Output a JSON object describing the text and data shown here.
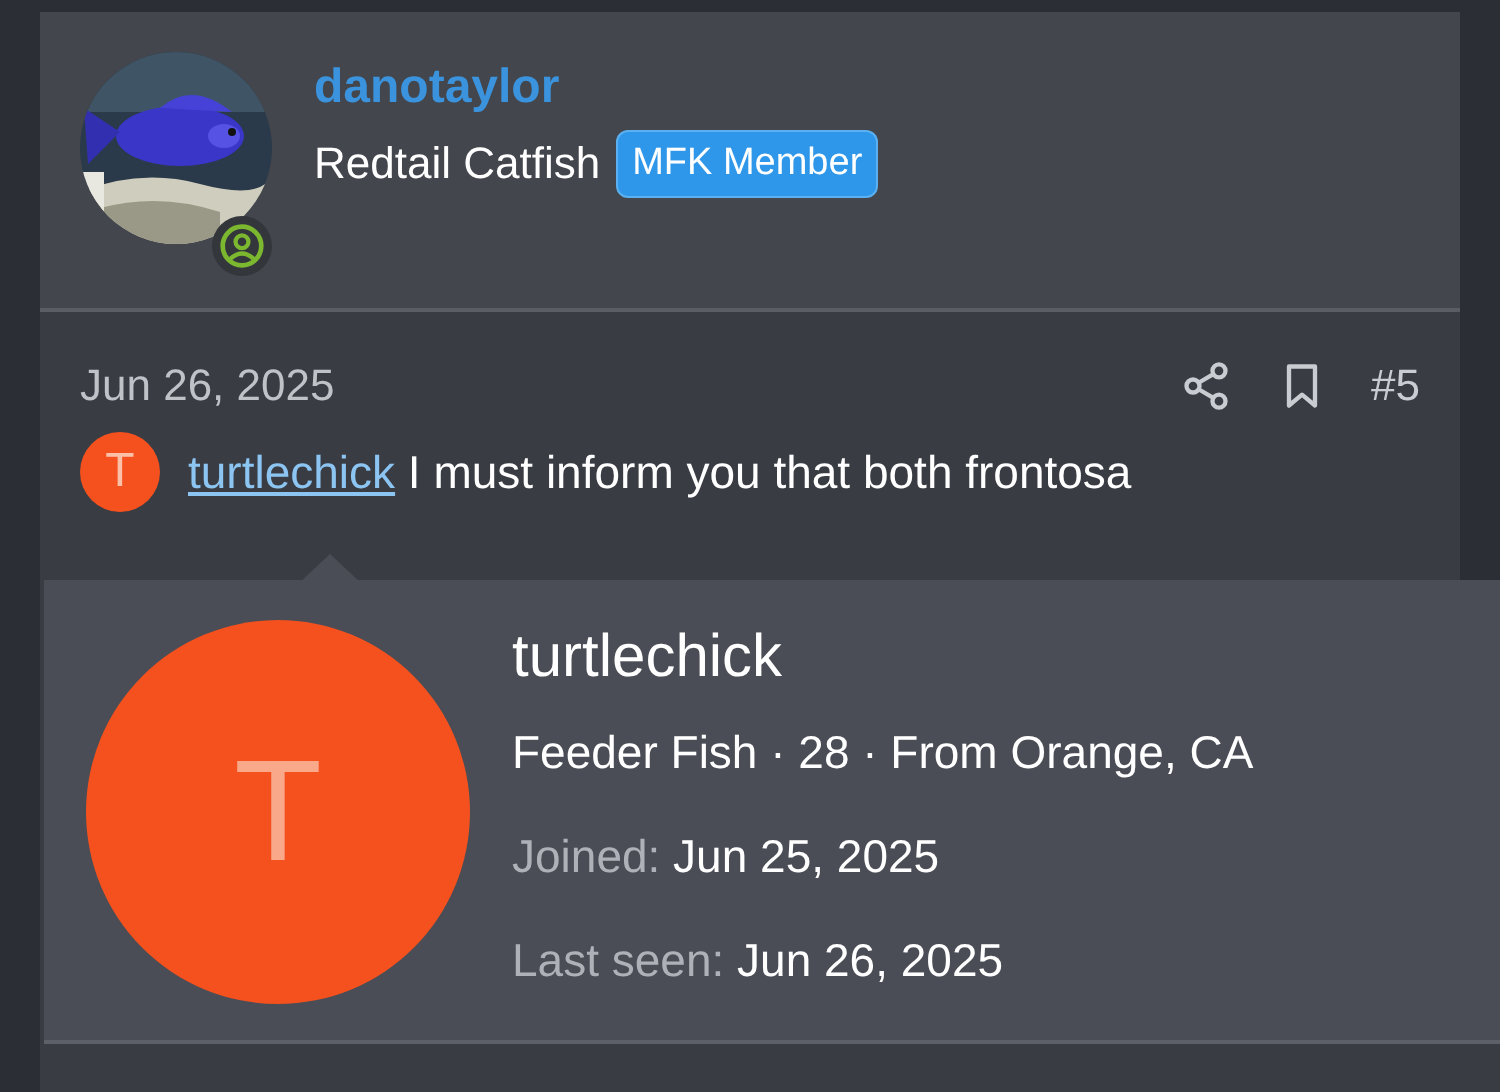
{
  "author": {
    "name": "danotaylor",
    "title": "Redtail Catfish",
    "badge": "MFK Member",
    "online": true
  },
  "post": {
    "date": "Jun 26, 2025",
    "number": "#5",
    "mention": {
      "initial": "T",
      "color": "#f4511e",
      "username": "turtlechick"
    },
    "text": "I must inform you that both frontosa"
  },
  "member_card": {
    "initial": "T",
    "color": "#f4511e",
    "username": "turtlechick",
    "info": "Feeder Fish · 28 · From Orange, CA",
    "stats": [
      {
        "label": "Joined:",
        "value": "Jun 25, 2025"
      },
      {
        "label": "Last seen:",
        "value": "Jun 26, 2025"
      }
    ]
  }
}
